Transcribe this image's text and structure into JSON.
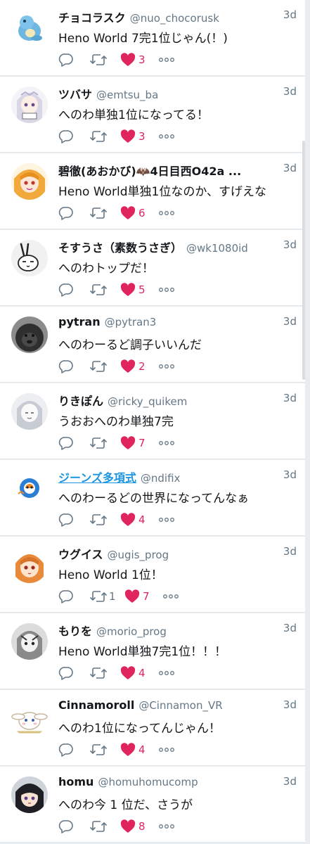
{
  "tweets": [
    {
      "name": "チョコラスク",
      "handle": "@nuo_chocorusk",
      "time": "3d",
      "text": "Heno World 7完1位じゃん(！)",
      "retweets": "",
      "likes": "3",
      "avatar": "avatar-chocorusk"
    },
    {
      "name": "ツバサ",
      "handle": "@emtsu_ba",
      "time": "3d",
      "text": "へのわ単独1位になってる！",
      "retweets": "",
      "likes": "3",
      "avatar": "avatar-tsubasa"
    },
    {
      "name": "碧徹(あおかび)🦇4日目西O42a ...",
      "handle": "",
      "time": "3d",
      "text": "Heno World単独1位なのか、すげえな",
      "retweets": "",
      "likes": "6",
      "avatar": "avatar-aokabi"
    },
    {
      "name": "そすうさ（素数うさぎ）",
      "handle": "@wk1080id",
      "time": "3d",
      "text": "へのわトップだ！",
      "retweets": "",
      "likes": "5",
      "avatar": "avatar-sosusa"
    },
    {
      "name": "pytran",
      "handle": "@pytran3",
      "time": "3d",
      "text": "へのわーるど調子いいんだ",
      "retweets": "",
      "likes": "2",
      "avatar": "avatar-pytran"
    },
    {
      "name": "りきぽん",
      "handle": "@ricky_quikem",
      "time": "3d",
      "text": "うおおへのわ単独7完",
      "retweets": "",
      "likes": "7",
      "avatar": "avatar-rikipon"
    },
    {
      "name": "ジーンズ多項式",
      "handle": "@ndifix",
      "time": "3d",
      "text": "へのわーるどの世界になってんなぁ",
      "retweets": "",
      "likes": "4",
      "avatar": "avatar-jeans",
      "name_is_link": true
    },
    {
      "name": "ウグイス",
      "handle": "@ugis_prog",
      "time": "3d",
      "text": "Heno World 1位！",
      "retweets": "1",
      "likes": "7",
      "avatar": "avatar-uguisu"
    },
    {
      "name": "もりを",
      "handle": "@morio_prog",
      "time": "3d",
      "text": "Heno World単独7完1位！！！",
      "retweets": "",
      "likes": "4",
      "avatar": "avatar-morio"
    },
    {
      "name": "Cinnamoroll",
      "handle": "@Cinnamon_VR",
      "time": "3d",
      "text": "へのわ1位になってんじゃん！",
      "retweets": "",
      "likes": "4",
      "avatar": "avatar-cinnamoroll"
    },
    {
      "name": "homu",
      "handle": "@homuhomucomp",
      "time": "3d",
      "text": "へのわ今 1 位だ、さうが",
      "retweets": "",
      "likes": "8",
      "avatar": "avatar-homu"
    }
  ],
  "colors": {
    "like": "#e0245e",
    "icon": "#657786",
    "name": "#14171a",
    "link": "#1b95e0",
    "divider": "#e3e7ea"
  }
}
